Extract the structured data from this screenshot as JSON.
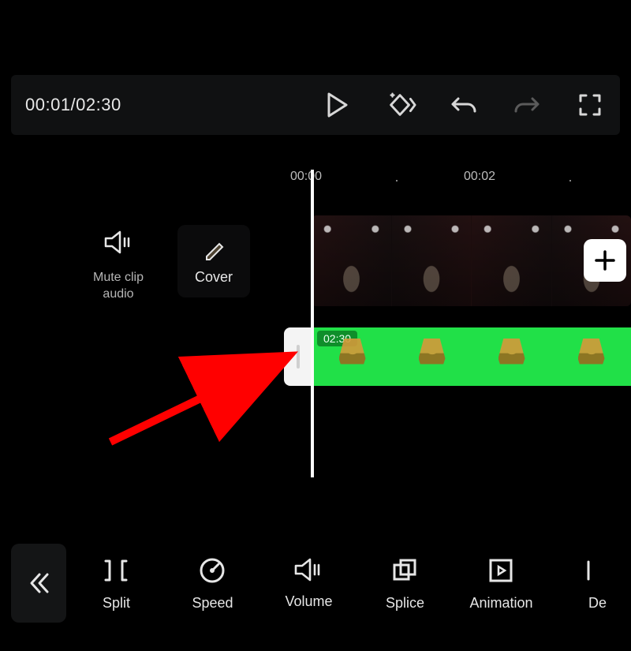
{
  "playback": {
    "current": "00:01",
    "total": "02:30",
    "display": "00:01/02:30"
  },
  "ruler": {
    "ticks": [
      "00:00",
      "00:02"
    ]
  },
  "sidebar": {
    "mute_label_line1": "Mute clip",
    "mute_label_line2": "audio",
    "cover_label": "Cover"
  },
  "clip_overlay": {
    "duration_badge": "02:30"
  },
  "bottom_tools": {
    "items": [
      {
        "label": "Split"
      },
      {
        "label": "Speed"
      },
      {
        "label": "Volume"
      },
      {
        "label": "Splice"
      },
      {
        "label": "Animation"
      },
      {
        "label": "De"
      }
    ]
  },
  "colors": {
    "accent_green": "#21e048",
    "annotation_red": "#ff0000"
  }
}
